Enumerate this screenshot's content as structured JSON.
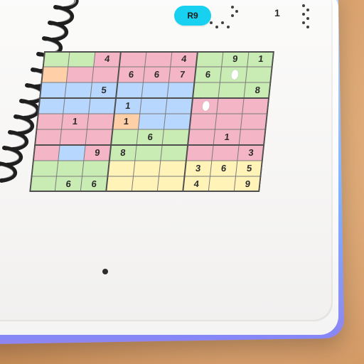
{
  "header": {
    "badge": "R9",
    "digit": "1"
  },
  "sudoku": {
    "rows": 9,
    "cols": 9,
    "given": [
      {
        "r": 0,
        "c": 2,
        "v": "4"
      },
      {
        "r": 0,
        "c": 5,
        "v": "4"
      },
      {
        "r": 0,
        "c": 7,
        "v": "9"
      },
      {
        "r": 0,
        "c": 8,
        "v": "1"
      },
      {
        "r": 1,
        "c": 3,
        "v": "6"
      },
      {
        "r": 1,
        "c": 4,
        "v": "6"
      },
      {
        "r": 1,
        "c": 5,
        "v": "7"
      },
      {
        "r": 1,
        "c": 6,
        "v": "6"
      },
      {
        "r": 2,
        "c": 2,
        "v": "5"
      },
      {
        "r": 2,
        "c": 8,
        "v": "8"
      },
      {
        "r": 3,
        "c": 3,
        "v": "1"
      },
      {
        "r": 4,
        "c": 1,
        "v": "1"
      },
      {
        "r": 4,
        "c": 3,
        "v": "1"
      },
      {
        "r": 5,
        "c": 4,
        "v": "6"
      },
      {
        "r": 5,
        "c": 7,
        "v": "1"
      },
      {
        "r": 6,
        "c": 2,
        "v": "9"
      },
      {
        "r": 6,
        "c": 3,
        "v": "8"
      },
      {
        "r": 6,
        "c": 8,
        "v": "3"
      },
      {
        "r": 7,
        "c": 6,
        "v": "3"
      },
      {
        "r": 7,
        "c": 7,
        "v": "6"
      },
      {
        "r": 7,
        "c": 8,
        "v": "5"
      },
      {
        "r": 8,
        "c": 1,
        "v": "6"
      },
      {
        "r": 8,
        "c": 2,
        "v": "6"
      },
      {
        "r": 8,
        "c": 6,
        "v": "4"
      },
      {
        "r": 8,
        "c": 8,
        "v": "9"
      }
    ]
  },
  "colors": {
    "pink": "#f4b6c6",
    "green": "#c9ebb4",
    "blue": "#b7d7ff",
    "yellow": "#fff3b8",
    "orange": "#ffd0a8",
    "grid_line": "#4f4f4f",
    "thin_line": "#7b7b7b"
  }
}
